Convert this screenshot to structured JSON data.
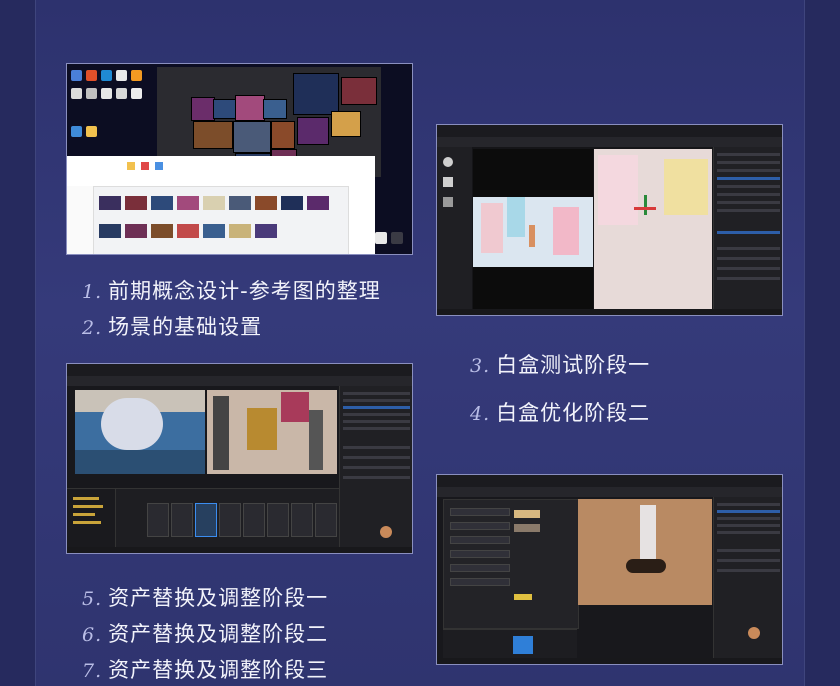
{
  "captions": {
    "c1": {
      "num": "1.",
      "text": "前期概念设计-参考图的整理"
    },
    "c2": {
      "num": "2.",
      "text": "场景的基础设置"
    },
    "c3": {
      "num": "3.",
      "text": "白盒测试阶段一"
    },
    "c4": {
      "num": "4.",
      "text": "白盒优化阶段二"
    },
    "c5": {
      "num": "5.",
      "text": "资产替换及调整阶段一"
    },
    "c6": {
      "num": "6.",
      "text": "资产替换及调整阶段二"
    },
    "c7": {
      "num": "7.",
      "text": "资产替换及调整阶段三"
    }
  },
  "colors": {
    "background": "#2b2f6b",
    "panel": "#343979",
    "caption_text": "#f2f3fb",
    "caption_number": "#b9bde6",
    "editor_select": "#2d5ea8"
  },
  "screenshots": [
    {
      "id": "reference-desktop",
      "icon": "desktop-screenshot"
    },
    {
      "id": "whitebox-viewport",
      "icon": "editor-screenshot"
    },
    {
      "id": "asset-replacement-editor",
      "icon": "editor-screenshot"
    },
    {
      "id": "material-editor",
      "icon": "editor-screenshot"
    }
  ]
}
